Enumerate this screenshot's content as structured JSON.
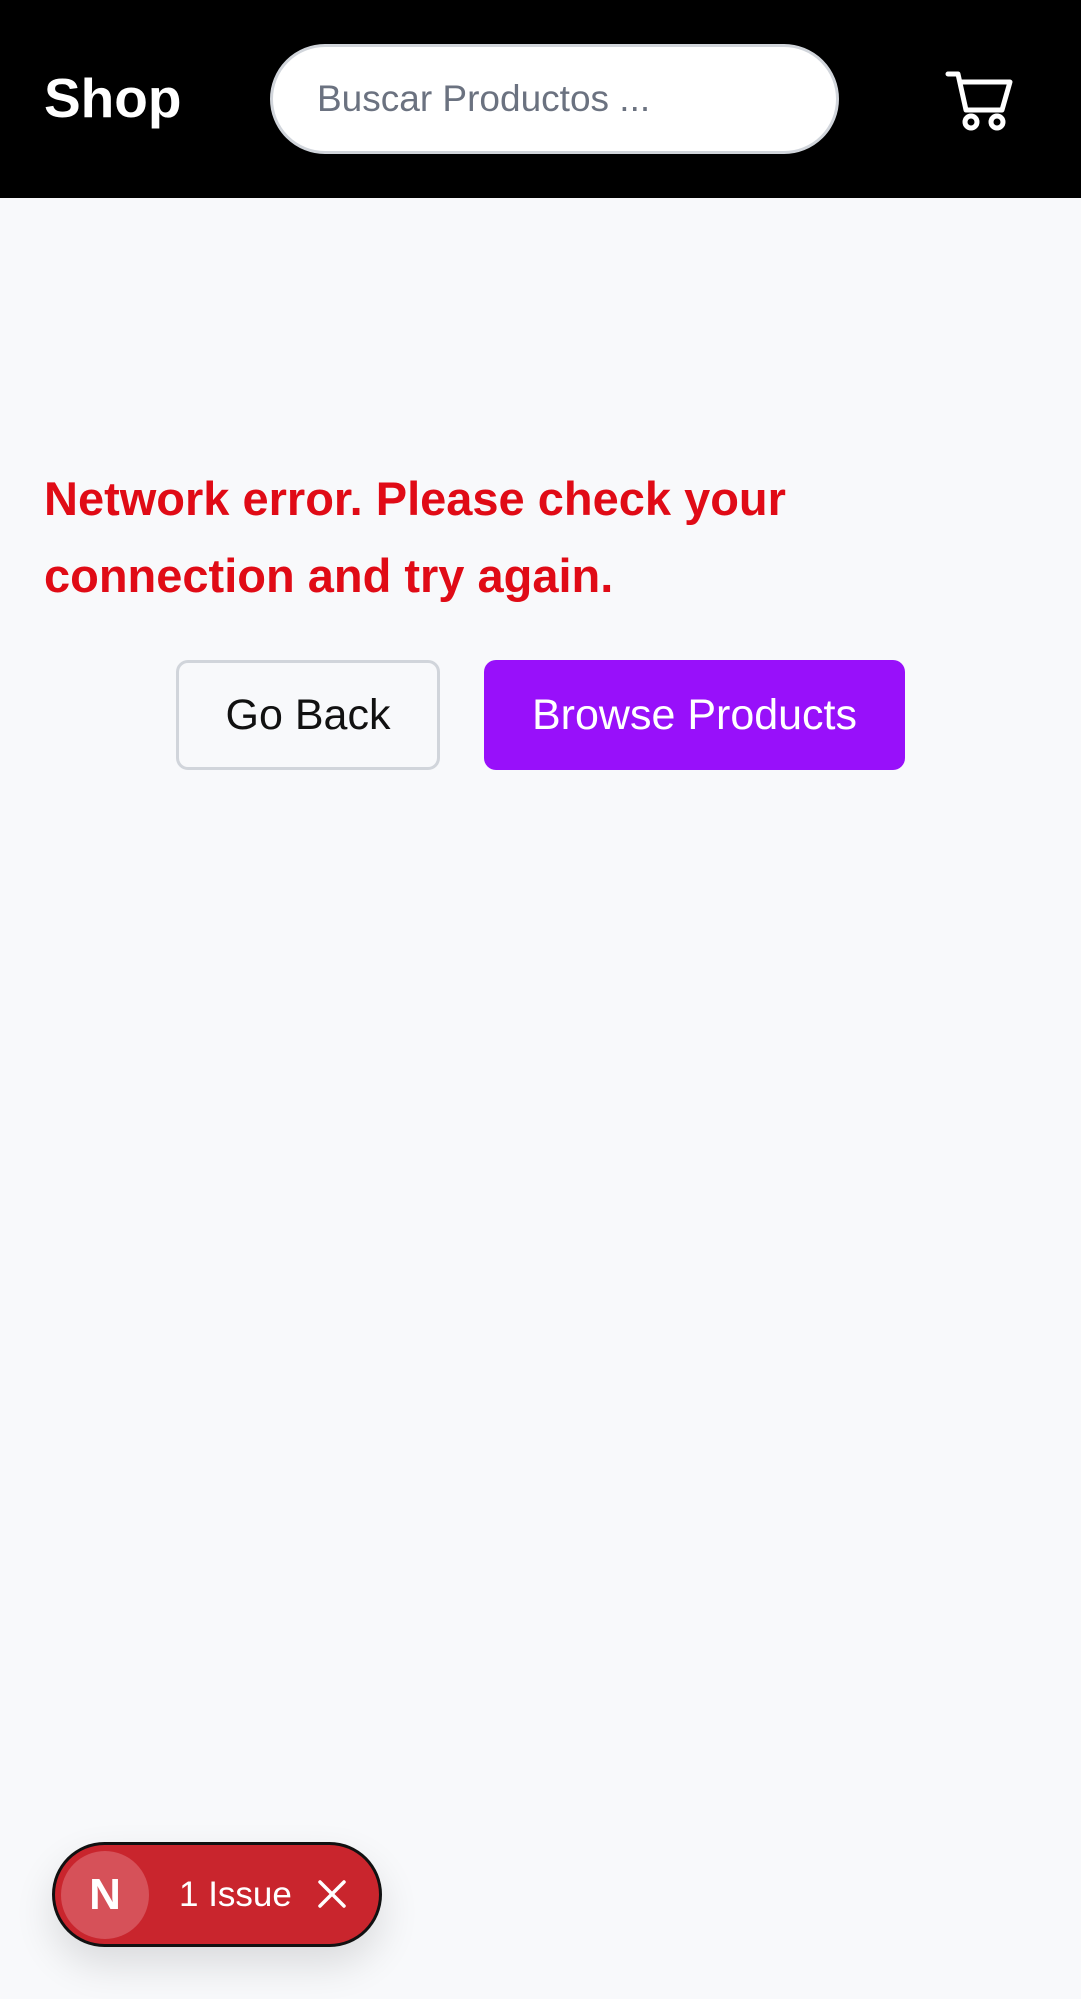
{
  "header": {
    "brand": "Shop",
    "search_placeholder": "Buscar Productos ...",
    "cart_icon": "cart-icon"
  },
  "main": {
    "error_message": "Network error. Please check your connection and try again.",
    "go_back_label": "Go Back",
    "browse_label": "Browse Products"
  },
  "dev_overlay": {
    "badge_letter": "N",
    "issues_label": "1 Issue",
    "close_icon": "close-icon"
  },
  "colors": {
    "header_bg": "#000000",
    "page_bg": "#f8f9fb",
    "error_text": "#e00b16",
    "primary_button": "#9810fa",
    "issues_pill": "#c9252d"
  }
}
